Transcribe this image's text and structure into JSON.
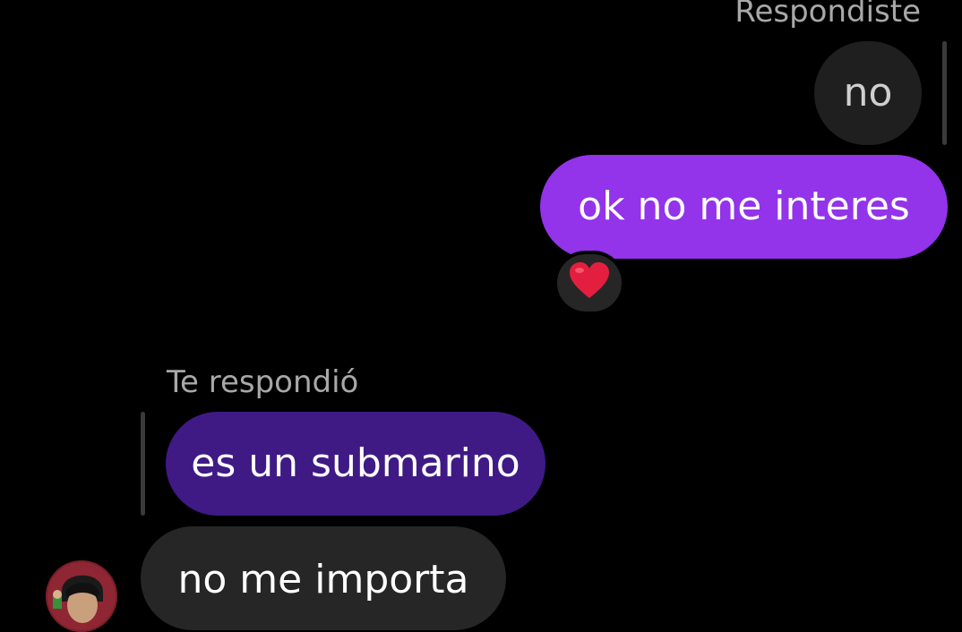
{
  "thread": {
    "outgoing_reply": {
      "label": "Respondiste",
      "quoted_text": "no"
    },
    "outgoing_message": {
      "text": "ok no me interes",
      "reaction_icon": "heart-emoji"
    },
    "incoming_reply": {
      "label": "Te respondió",
      "quoted_text": "es un submarino"
    },
    "incoming_message": {
      "text": "no me importa"
    }
  },
  "colors": {
    "background": "#000000",
    "sent_bubble": "#9333ea",
    "quoted_incoming_bubble": "#3f1a85",
    "received_bubble": "#262626",
    "quoted_outgoing_bubble": "#1f1f1f",
    "reaction_heart": "#e41e3f"
  }
}
